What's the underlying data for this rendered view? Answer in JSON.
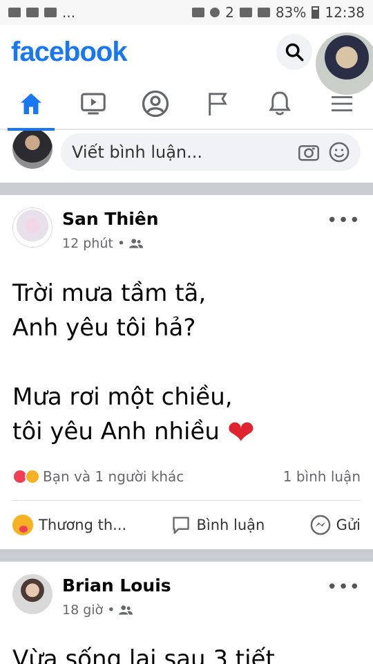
{
  "status": {
    "battery": "83%",
    "time": "12:38",
    "sim": "2",
    "dots": "..."
  },
  "app": {
    "logo": "facebook"
  },
  "composer": {
    "placeholder": "Viết bình luận..."
  },
  "posts": [
    {
      "author": "San Thiên",
      "time": "12 phút",
      "body_lines": [
        "Trời mưa tầm tã,",
        "Anh yêu tôi hả?",
        "Mưa rơi một chiều,",
        "tôi yêu Anh nhiều"
      ],
      "heart": "❤",
      "reactions_text": "Bạn và 1 người khác",
      "comments_count": "1 bình luận",
      "actions": {
        "react": "Thương th...",
        "comment": "Bình luận",
        "send": "Gửi"
      }
    },
    {
      "author": "Brian Louis",
      "time": "18 giờ",
      "body_preview": "Vừa sống lại sau 3 tiết"
    }
  ],
  "ui": {
    "meta_separator": "•",
    "more": "•••"
  }
}
